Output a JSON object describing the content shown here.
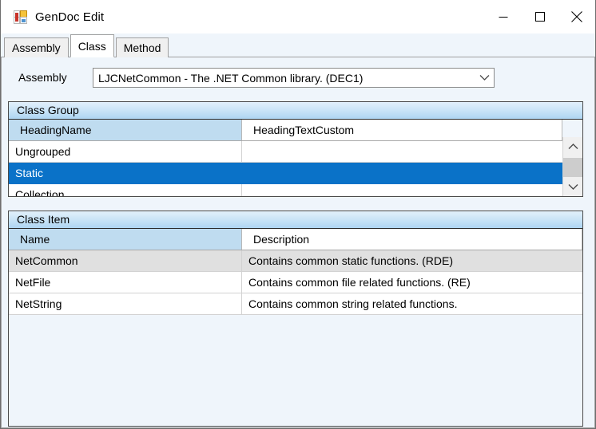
{
  "window": {
    "title": "GenDoc Edit",
    "icon": "app-grid-icon",
    "controls": {
      "minimize": "minimize-icon",
      "maximize": "maximize-icon",
      "close": "close-icon"
    }
  },
  "tabs": [
    {
      "label": "Assembly",
      "selected": false
    },
    {
      "label": "Class",
      "selected": true
    },
    {
      "label": "Method",
      "selected": false
    }
  ],
  "assembly": {
    "label": "Assembly",
    "value": "LJCNetCommon - The .NET Common library. (DEC1)",
    "arrow_icon": "chevron-down-icon"
  },
  "class_group": {
    "title": "Class Group",
    "columns": [
      "HeadingName",
      "HeadingTextCustom"
    ],
    "sort_column": "HeadingName",
    "rows": [
      {
        "HeadingName": "Ungrouped",
        "HeadingTextCustom": "",
        "state": "normal"
      },
      {
        "HeadingName": "Static",
        "HeadingTextCustom": "",
        "state": "selected"
      },
      {
        "HeadingName": "Collection",
        "HeadingTextCustom": "",
        "state": "normal"
      }
    ],
    "scrollbar": {
      "up_icon": "chevron-up-icon",
      "down_icon": "chevron-down-icon"
    }
  },
  "class_item": {
    "title": "Class Item",
    "columns": [
      "Name",
      "Description"
    ],
    "sort_column": "Name",
    "rows": [
      {
        "Name": "NetCommon",
        "Description": "Contains common static functions. (RDE)",
        "state": "alt"
      },
      {
        "Name": "NetFile",
        "Description": "Contains common file related functions. (RE)",
        "state": "normal"
      },
      {
        "Name": "NetString",
        "Description": "Contains common string related functions.",
        "state": "normal"
      }
    ]
  },
  "colors": {
    "selection_blue": "#0a72c8",
    "panel_header_blue": "#c9e4f7",
    "sort_column_blue": "#bfdcf0",
    "page_background": "#eff5fb",
    "alt_row_gray": "#e0e0e0"
  }
}
